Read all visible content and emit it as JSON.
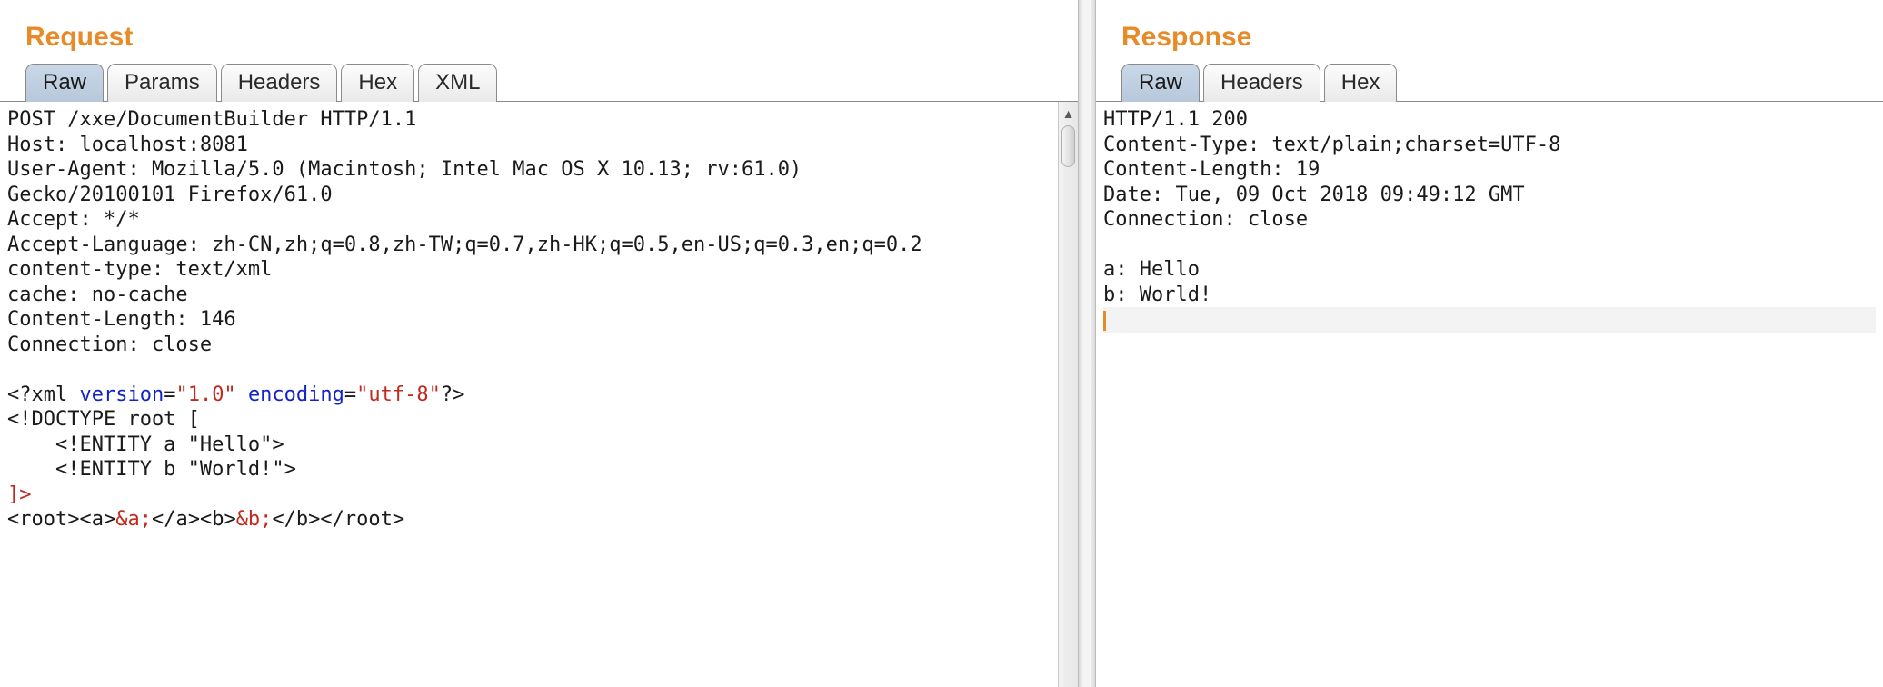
{
  "request": {
    "title": "Request",
    "tabs": {
      "raw": "Raw",
      "params": "Params",
      "headers": "Headers",
      "hex": "Hex",
      "xml": "XML"
    },
    "http": {
      "line1": "POST /xxe/DocumentBuilder HTTP/1.1",
      "line2": "Host: localhost:8081",
      "line3": "User-Agent: Mozilla/5.0 (Macintosh; Intel Mac OS X 10.13; rv:61.0)",
      "line4": "Gecko/20100101 Firefox/61.0",
      "line5": "Accept: */*",
      "line6": "Accept-Language: zh-CN,zh;q=0.8,zh-TW;q=0.7,zh-HK;q=0.5,en-US;q=0.3,en;q=0.2",
      "line7": "content-type: text/xml",
      "line8": "cache: no-cache",
      "line9": "Content-Length: 146",
      "line10": "Connection: close"
    },
    "xml": {
      "decl_open": "<?xml ",
      "attr_version_name": "version",
      "eq1": "=",
      "attr_version_val": "\"1.0\"",
      "sp1": " ",
      "attr_encoding_name": "encoding",
      "eq2": "=",
      "attr_encoding_val": "\"utf-8\"",
      "decl_close": "?>",
      "doctype": "<!DOCTYPE root [",
      "entity_a": "    <!ENTITY a \"Hello\">",
      "entity_b": "    <!ENTITY b \"World!\">",
      "doctype_close": "]>",
      "root_open_a": "<root><a>",
      "ent_a": "&a;",
      "close_a_open_b": "</a><b>",
      "ent_b": "&b;",
      "close_b_root": "</b></root>"
    }
  },
  "response": {
    "title": "Response",
    "tabs": {
      "raw": "Raw",
      "headers": "Headers",
      "hex": "Hex"
    },
    "body": {
      "l1": "HTTP/1.1 200",
      "l2": "Content-Type: text/plain;charset=UTF-8",
      "l3": "Content-Length: 19",
      "l4": "Date: Tue, 09 Oct 2018 09:49:12 GMT",
      "l5": "Connection: close",
      "blank": "",
      "l6": "a: Hello",
      "l7": "b: World!"
    }
  }
}
